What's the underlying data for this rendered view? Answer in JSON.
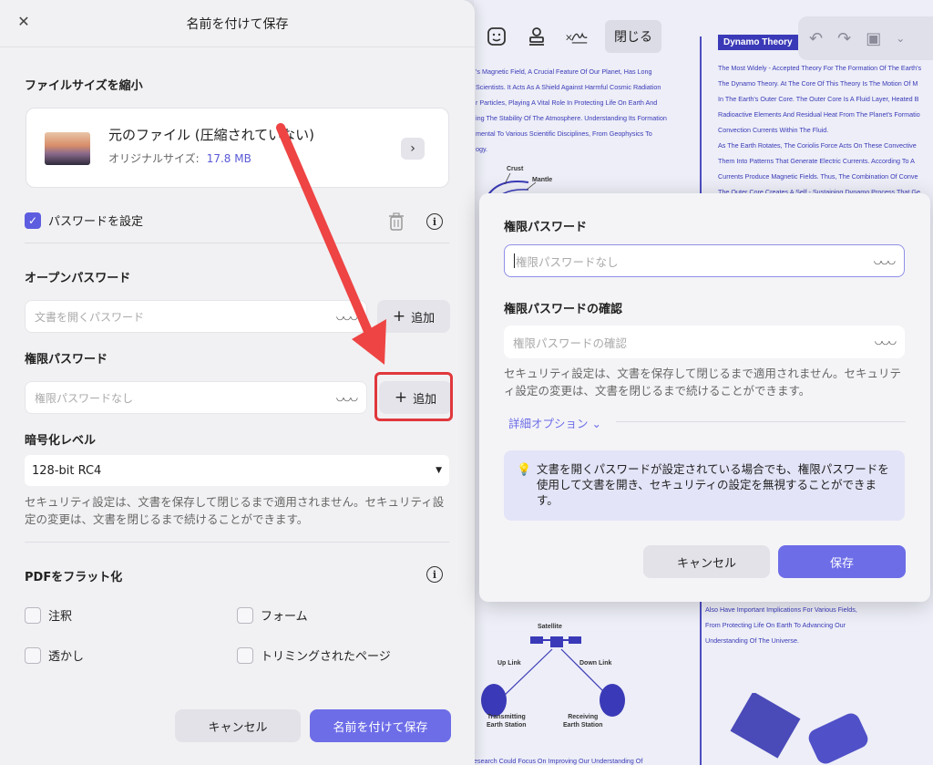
{
  "document": {
    "toolbar": {
      "icons": [
        "sticker-icon",
        "stamp-icon",
        "signature-icon"
      ],
      "close_label": "閉じる"
    },
    "title": "Dynamo Theory",
    "left_lines": [
      "'s Magnetic Field, A Crucial Feature Of Our Planet, Has Long",
      "Scientists. It Acts As A Shield Against Harmful Cosmic Radiation",
      "r Particles, Playing A Vital Role In Protecting Life On Earth And",
      "ing The Stability Of The Atmosphere. Understanding Its Formation",
      "mental To Various Scientific Disciplines, From Geophysics To",
      "ogy."
    ],
    "right_lines": [
      "The Most Widely - Accepted Theory For The Formation Of The Earth's",
      "The Dynamo Theory. At The Core Of This Theory Is The Motion Of M",
      "In The Earth's Outer Core. The Outer Core Is A Fluid Layer, Heated B",
      "Radioactive Elements And Residual Heat From The Planet's Formatio",
      "Convection Currents Within The Fluid.",
      "As The Earth Rotates, The Coriolis Force Acts On These Convective",
      "Them Into Patterns That Generate Electric Currents. According To A",
      "Currents Produce Magnetic Fields. Thus, The Combination Of Conve",
      "The Outer Core Creates A Self - Sustaining Dynamo Process That Ge"
    ],
    "right_bottom_lines": [
      "Also Have Important Implications For Various Fields,",
      "From Protecting Life On Earth To Advancing Our",
      "Understanding Of The Universe."
    ],
    "diagram_labels": {
      "crust": "Crust",
      "mantle": "Mantle",
      "satellite": "Satellite",
      "up_link": "Up Link",
      "down_link": "Down Link",
      "transmitting": "Transmitting\nEarth Station",
      "receiving": "Receiving\nEarth Station"
    },
    "footer_line": "esearch Could Focus On Improving Our Understanding Of"
  },
  "save_dialog": {
    "title": "名前を付けて保存",
    "reduce_section": "ファイルサイズを縮小",
    "file_name": "元のファイル (圧縮されていない)",
    "original_size_label": "オリジナルサイズ:",
    "original_size_value": "17.8 MB",
    "set_password_label": "パスワードを設定",
    "set_password_checked": true,
    "open_password_title": "オープンパスワード",
    "open_password_placeholder": "文書を開くパスワード",
    "add_label": "追加",
    "permission_password_title": "権限パスワード",
    "permission_password_placeholder": "権限パスワードなし",
    "encryption_title": "暗号化レベル",
    "encryption_value": "128-bit RC4",
    "security_note": "セキュリティ設定は、文書を保存して閉じるまで適用されません。セキュリティ設定の変更は、文書を閉じるまで続けることができます。",
    "flatten_title": "PDFをフラット化",
    "flatten_options": {
      "annotation": "注釈",
      "form": "フォーム",
      "watermark": "透かし",
      "cropped": "トリミングされたページ"
    },
    "cancel_label": "キャンセル",
    "save_as_label": "名前を付けて保存"
  },
  "permission_dialog": {
    "password_label": "権限パスワード",
    "password_placeholder": "権限パスワードなし",
    "confirm_label": "権限パスワードの確認",
    "confirm_placeholder": "権限パスワードの確認",
    "note": "セキュリティ設定は、文書を保存して閉じるまで適用されません。セキュリティ設定の変更は、文書を閉じるまで続けることができます。",
    "advanced_label": "詳細オプション",
    "hint": "文書を開くパスワードが設定されている場合でも、権限パスワードを使用して文書を開き、セキュリティの設定を無視することができます。",
    "cancel_label": "キャンセル",
    "save_label": "保存"
  },
  "colors": {
    "accent": "#6d6de8",
    "highlight": "#e0383c",
    "doc_text": "#3a3ab8"
  }
}
